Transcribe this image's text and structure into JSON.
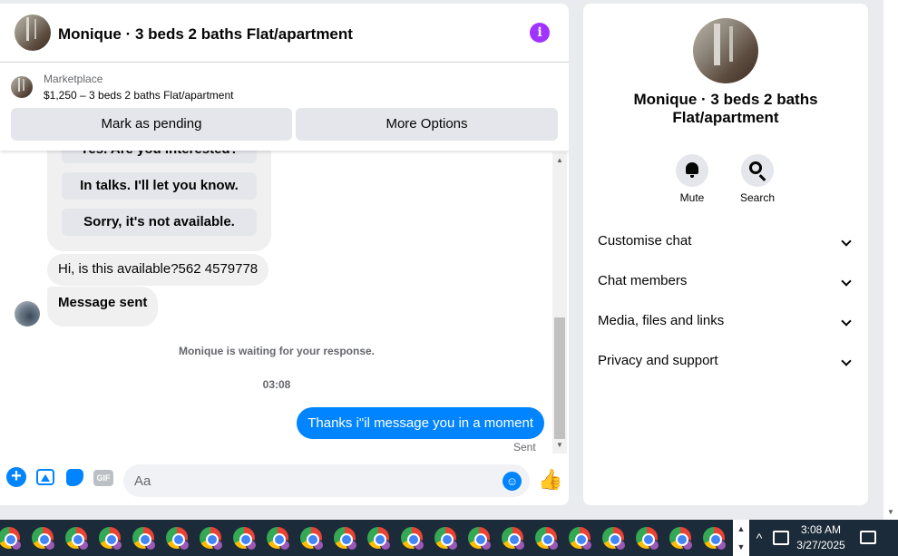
{
  "chat": {
    "title": "Monique · 3 beds 2 baths Flat/apartment",
    "info_icon": "i"
  },
  "listing": {
    "source": "Marketplace",
    "price_line": "$1,250 – 3 beds 2 baths Flat/apartment",
    "mark_pending_label": "Mark as pending",
    "more_options_label": "More Options"
  },
  "messages": {
    "quick_replies": [
      "Yes. Are you interested?",
      "In talks. I'll let you know.",
      "Sorry, it's not available."
    ],
    "incoming_1": "Hi, is this available?562 4579778",
    "incoming_2": "Message sent",
    "waiting_notice": "Monique is waiting for your response.",
    "timestamp": "03:08",
    "outgoing_1": "Thanks i\"il message you in a moment",
    "outgoing_status": "Sent"
  },
  "composer": {
    "placeholder": "Aa",
    "gif_label": "GIF"
  },
  "info_panel": {
    "title": "Monique · 3 beds 2 baths Flat/apartment",
    "mute_label": "Mute",
    "search_label": "Search",
    "sections": [
      "Customise chat",
      "Chat members",
      "Media, files and links",
      "Privacy and support"
    ]
  },
  "taskbar": {
    "time": "3:08 AM",
    "date": "3/27/2025",
    "app_icon": "chrome-icon",
    "app_count": 22
  },
  "colors": {
    "accent": "#0084ff",
    "info": "#a033ff",
    "bubble_in": "#f0f0f0",
    "taskbar": "#1c2b3a"
  }
}
